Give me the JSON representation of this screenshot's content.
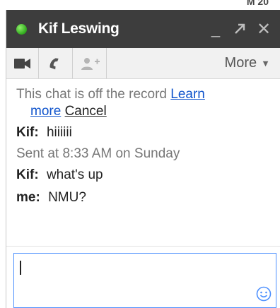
{
  "window": {
    "title": "Kif Leswing",
    "status": "online",
    "status_color": "#3cb72a"
  },
  "titlebar": {
    "minimize_label": "_",
    "popout_icon": "arrow-out-icon",
    "close_label": "✕"
  },
  "toolbar": {
    "video_icon": "video-camera-icon",
    "call_icon": "phone-icon",
    "add_person_icon": "add-person-icon",
    "more_label": "More",
    "more_arrow": "▼"
  },
  "notice": {
    "text": "This chat is off the record",
    "learn_more_1": "Learn",
    "learn_more_2": "more",
    "cancel": "Cancel"
  },
  "messages": [
    {
      "sender": "Kif:",
      "text": "hiiiiii"
    },
    {
      "sender": "Kif:",
      "text": "what's up"
    },
    {
      "sender": "me:",
      "text": "NMU?"
    }
  ],
  "timestamp": "Sent at 8:33 AM on Sunday",
  "composer": {
    "value": "",
    "emoji_icon": "smiley-icon"
  }
}
